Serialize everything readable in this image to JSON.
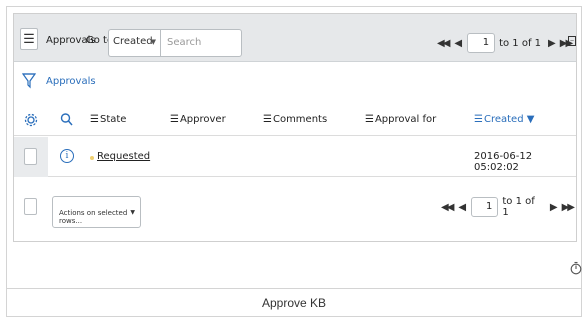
{
  "header": {
    "title": "Approvals",
    "goto_label": "Go to",
    "goto_select_value": "Created",
    "search_placeholder": "Search"
  },
  "pager_top": {
    "page": "1",
    "of_text": "to 1 of 1"
  },
  "breadcrumb": {
    "label": "Approvals"
  },
  "columns": {
    "state": "State",
    "approver": "Approver",
    "comments": "Comments",
    "approval_for": "Approval for",
    "created": "Created"
  },
  "rows": [
    {
      "state": "Requested",
      "approver": "",
      "comments": "",
      "approval_for": "",
      "created": "2016-06-12 05:02:02"
    }
  ],
  "footer": {
    "actions_label": "Actions on selected rows...",
    "page": "1",
    "of_text": "to 1 of 1"
  },
  "bottom_bar": {
    "label": "Approve KB"
  },
  "colors": {
    "link": "#2a6ebb",
    "header_bg": "#e6e8ea",
    "state_dot": "#f0d070"
  },
  "icons": {
    "menu": "hamburger-icon",
    "filter": "funnel-icon",
    "settings": "gear-icon",
    "search": "search-icon",
    "info": "info-icon",
    "timer": "timer-icon",
    "collapse": "collapse-icon"
  }
}
